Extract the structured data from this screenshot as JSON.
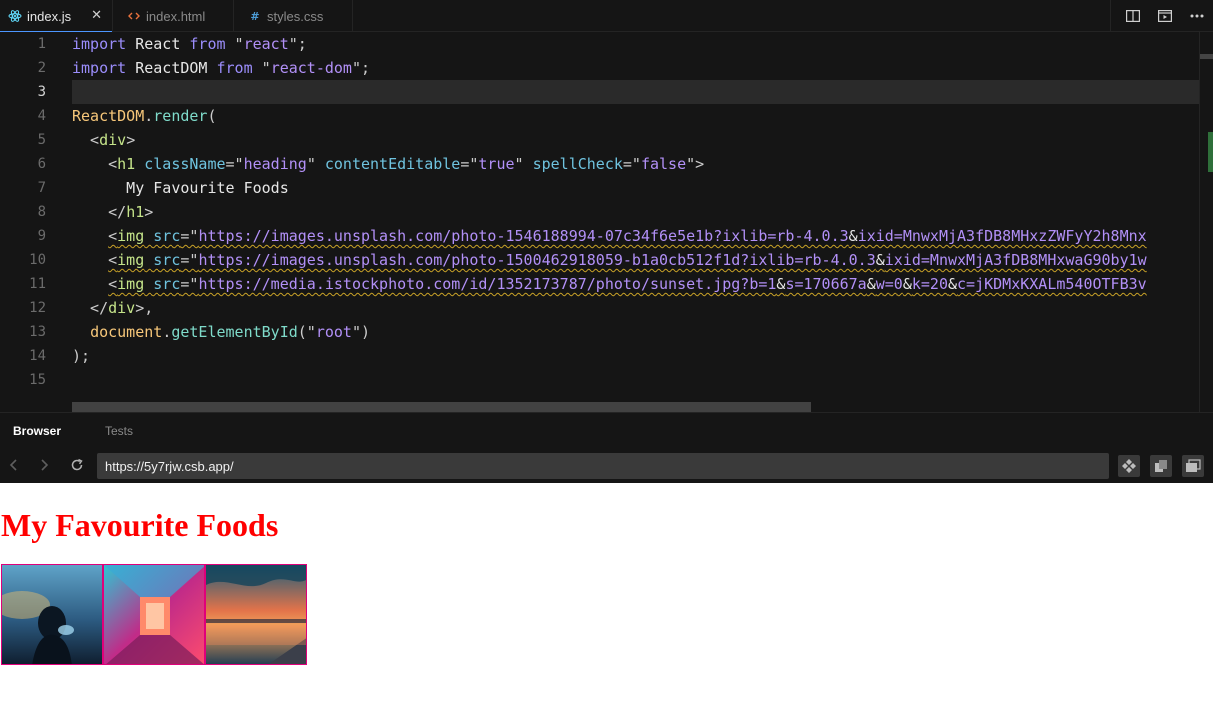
{
  "tabs": [
    {
      "label": "index.js",
      "icon": "react-icon",
      "active": true
    },
    {
      "label": "index.html",
      "icon": "html-code-icon",
      "active": false
    },
    {
      "label": "styles.css",
      "icon": "css-hash-icon",
      "active": false
    }
  ],
  "tab_actions": [
    "split-view-icon",
    "preview-icon",
    "more-options-icon"
  ],
  "close_glyph": "✕",
  "line_numbers": [
    "1",
    "2",
    "3",
    "4",
    "5",
    "6",
    "7",
    "8",
    "9",
    "10",
    "11",
    "12",
    "13",
    "14",
    "15"
  ],
  "code": {
    "l1": {
      "kw1": "import",
      "name": " React ",
      "kw2": "from",
      "q1": " \"",
      "str": "react",
      "q2": "\";"
    },
    "l2": {
      "kw1": "import",
      "name": " ReactDOM ",
      "kw2": "from",
      "q1": " \"",
      "str": "react-dom",
      "q2": "\";"
    },
    "l4": {
      "obj": "ReactDOM",
      "dot": ".",
      "fn": "render",
      "paren": "("
    },
    "l5": {
      "open": "  <",
      "tag": "div",
      "close": ">"
    },
    "l6": {
      "open": "    <",
      "tag": "h1",
      "a1": " className",
      "eq1": "=\"",
      "v1": "heading",
      "q1": "\"",
      "a2": " contentEditable",
      "eq2": "=\"",
      "v2": "true",
      "q2": "\"",
      "a3": " spellCheck",
      "eq3": "=\"",
      "v3": "false",
      "q3": "\">"
    },
    "l7": {
      "text": "      My Favourite Foods"
    },
    "l8": {
      "open": "    </",
      "tag": "h1",
      "close": ">"
    },
    "l9": {
      "indent": "    ",
      "lt": "<",
      "tag": "img",
      "attr": " src",
      "eq": "=\"",
      "url": "https://images.unsplash.com/photo-1546188994-07c34f6e5e1b?ixlib=rb-4.0.3",
      "amp": "&",
      "rest": "ixid=MnwxMjA3fDB8MHxzZWFyY2h8Mnx"
    },
    "l10": {
      "indent": "    ",
      "lt": "<",
      "tag": "img",
      "attr": " src",
      "eq": "=\"",
      "url": "https://images.unsplash.com/photo-1500462918059-b1a0cb512f1d?ixlib=rb-4.0.3",
      "amp": "&",
      "rest": "ixid=MnwxMjA3fDB8MHxwaG90by1w"
    },
    "l11": {
      "indent": "    ",
      "lt": "<",
      "tag": "img",
      "attr": " src",
      "eq": "=\"",
      "url": "https://media.istockphoto.com/id/1352173787/photo/sunset.jpg?b=1",
      "a1": "&",
      "p1": "s=170667a",
      "a2": "&",
      "p2": "w=0",
      "a3": "&",
      "p3": "k=20",
      "a4": "&",
      "p4": "c=jKDMxKXALm540OTFB3v"
    },
    "l12": {
      "open": "  </",
      "tag": "div",
      "close": ">,"
    },
    "l13": {
      "indent": "  ",
      "obj": "document",
      "dot": ".",
      "fn": "getElementById",
      "p1": "(\"",
      "str": "root",
      "p2": "\")"
    },
    "l14": {
      "text": ");"
    }
  },
  "panel": {
    "tabs": [
      {
        "label": "Browser",
        "active": true
      },
      {
        "label": "Tests",
        "active": false
      }
    ],
    "url": "https://5y7rjw.csb.app/"
  },
  "preview": {
    "heading": "My Favourite Foods",
    "heading_color": "#ff0000",
    "images": [
      "image-1",
      "image-2",
      "image-3"
    ]
  },
  "colors": {
    "accent": "#4c96ff",
    "image_border": "#e0007a"
  }
}
